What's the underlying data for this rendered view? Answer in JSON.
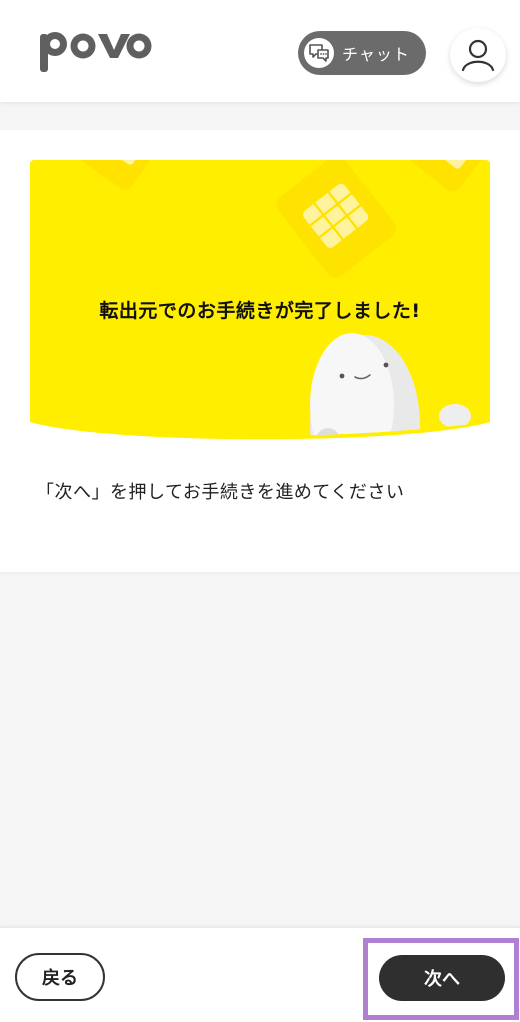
{
  "header": {
    "logo_text": "povo",
    "chat_label": "チャット",
    "chat_icon": "chat-bubble-icon",
    "account_icon": "user-icon"
  },
  "main": {
    "hero_title": "転出元でのお手続きが完了しました!",
    "instruction": "「次へ」を押してお手続きを進めてください"
  },
  "footer": {
    "back_label": "戻る",
    "next_label": "次へ"
  },
  "colors": {
    "hero_yellow": "#ffee00",
    "header_bg": "#ffffff",
    "page_bg": "#f5f5f5",
    "chat_button": "#6b6b6b",
    "next_button": "#2f2f2f",
    "highlight": "#b07fd0"
  }
}
